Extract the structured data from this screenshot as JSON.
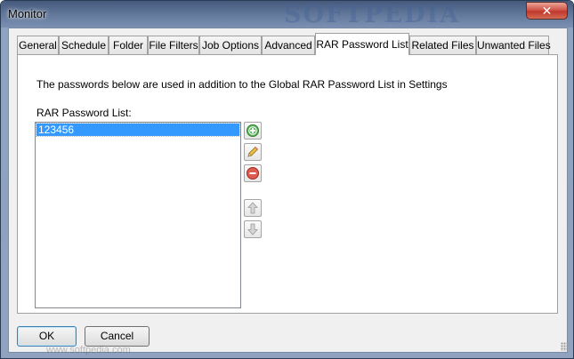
{
  "window": {
    "title": "Monitor",
    "watermark": "SOFTPEDIA",
    "close_glyph": "✕"
  },
  "tabs": [
    {
      "label": "General"
    },
    {
      "label": "Schedule"
    },
    {
      "label": "Folder"
    },
    {
      "label": "File Filters"
    },
    {
      "label": "Job Options"
    },
    {
      "label": "Advanced"
    },
    {
      "label": "RAR Password List"
    },
    {
      "label": "Related Files"
    },
    {
      "label": "Unwanted Files"
    }
  ],
  "active_tab": "RAR Password List",
  "panel": {
    "info_text": "The passwords below are used in addition to the Global RAR Password List in Settings",
    "list_label": "RAR Password List:",
    "passwords": [
      "123456"
    ],
    "side_buttons": {
      "add": "add-icon",
      "edit": "pencil-icon",
      "remove": "remove-icon",
      "up": "arrow-up-icon",
      "down": "arrow-down-icon"
    }
  },
  "buttons": {
    "ok": "OK",
    "cancel": "Cancel"
  },
  "footer_watermark": "www.softpedia.com",
  "colors": {
    "selection": "#3399ff",
    "titlebar": "#5f7598",
    "close": "#c0382c"
  }
}
